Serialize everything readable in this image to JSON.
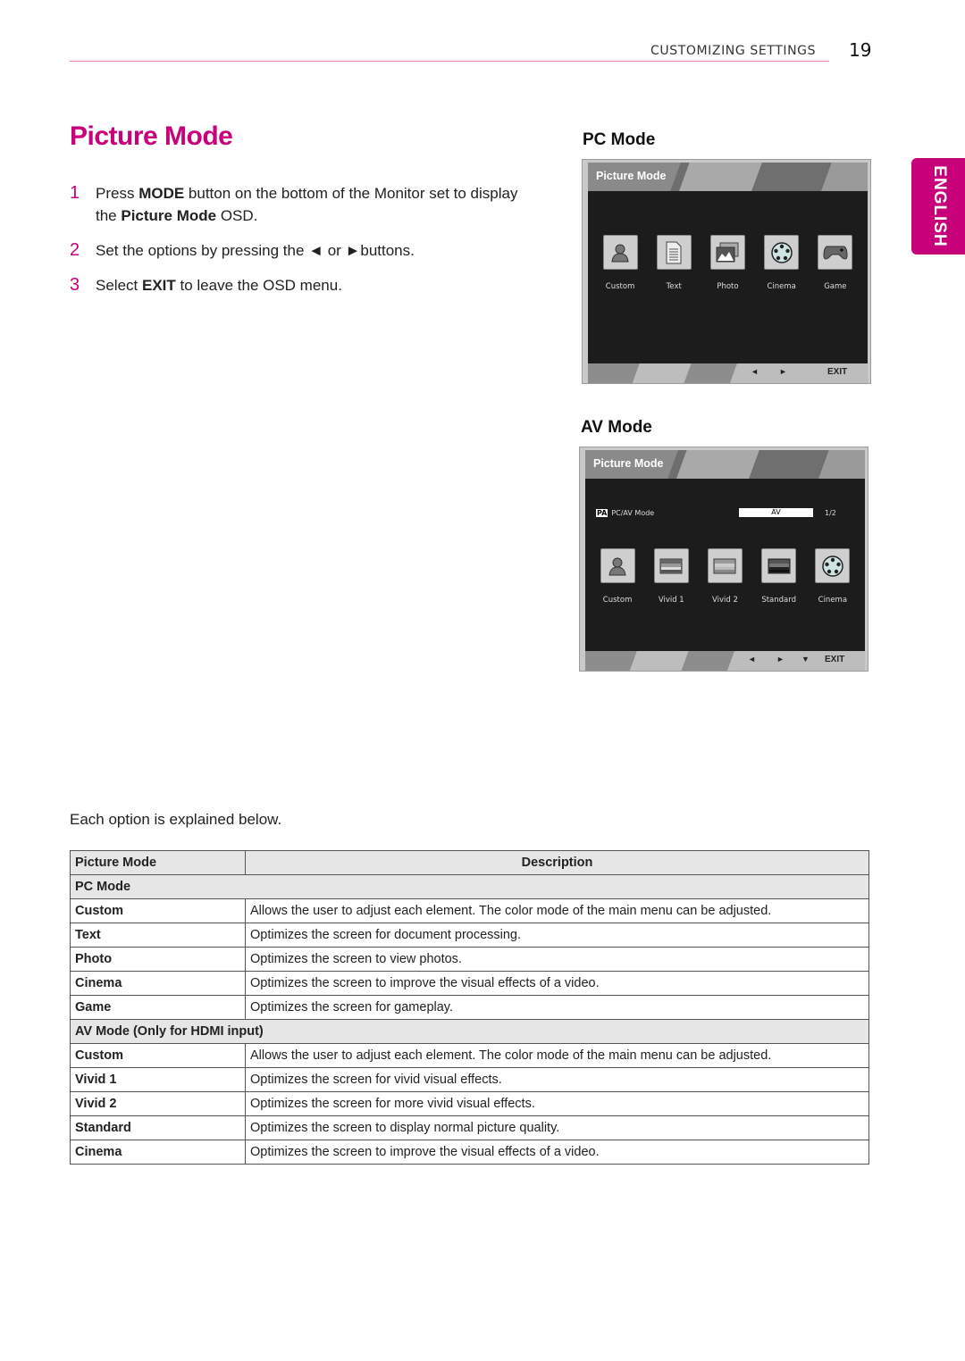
{
  "header": {
    "section": "CUSTOMIZING SETTINGS",
    "page_number": "19"
  },
  "language_tab": "ENGLISH",
  "title": "Picture Mode",
  "steps": [
    {
      "num": "1",
      "parts": [
        [
          "Press ",
          false
        ],
        [
          "MODE",
          true
        ],
        [
          " button on the bottom of the Monitor set to display the ",
          false
        ],
        [
          "Picture Mode",
          true
        ],
        [
          " OSD.",
          false
        ]
      ]
    },
    {
      "num": "2",
      "parts": [
        [
          "Set the options by pressing the ◄ or ►buttons.",
          false
        ]
      ]
    },
    {
      "num": "3",
      "parts": [
        [
          "Select ",
          false
        ],
        [
          "EXIT",
          true
        ],
        [
          " to leave the OSD menu.",
          false
        ]
      ]
    }
  ],
  "pc_osd": {
    "heading": "PC Mode",
    "title": "Picture Mode",
    "items": [
      {
        "label": "Custom",
        "icon": "person-icon"
      },
      {
        "label": "Text",
        "icon": "document-icon"
      },
      {
        "label": "Photo",
        "icon": "photo-icon"
      },
      {
        "label": "Cinema",
        "icon": "film-reel-icon"
      },
      {
        "label": "Game",
        "icon": "gamepad-icon"
      }
    ],
    "nav": {
      "left": "◄",
      "right": "►",
      "exit": "EXIT"
    }
  },
  "av_osd": {
    "heading": "AV Mode",
    "title": "Picture Mode",
    "pcav": {
      "badge": "PA",
      "label": "PC/AV Mode",
      "value": "AV",
      "page": "1/2"
    },
    "items": [
      {
        "label": "Custom",
        "icon": "person-icon"
      },
      {
        "label": "Vivid 1",
        "icon": "vivid1-icon"
      },
      {
        "label": "Vivid 2",
        "icon": "vivid2-icon"
      },
      {
        "label": "Standard",
        "icon": "standard-icon"
      },
      {
        "label": "Cinema",
        "icon": "film-reel-icon"
      }
    ],
    "nav": {
      "left": "◄",
      "right": "►",
      "down": "▼",
      "exit": "EXIT"
    }
  },
  "explain_text": "Each option is explained below.",
  "table": {
    "headers": [
      "Picture Mode",
      "Description"
    ],
    "groups": [
      {
        "name": "PC Mode",
        "rows": [
          [
            "Custom",
            "Allows the user to adjust each element. The color mode of the main menu can be adjusted."
          ],
          [
            "Text",
            "Optimizes the screen for document processing."
          ],
          [
            "Photo",
            "Optimizes the screen to view photos."
          ],
          [
            "Cinema",
            "Optimizes the screen to improve the visual effects of a video."
          ],
          [
            "Game",
            "Optimizes the screen for gameplay."
          ]
        ]
      },
      {
        "name": "AV Mode (Only for HDMI input)",
        "rows": [
          [
            "Custom",
            "Allows the user to adjust each element. The color mode of the main menu can be adjusted."
          ],
          [
            "Vivid 1",
            "Optimizes the screen for vivid visual effects."
          ],
          [
            "Vivid 2",
            "Optimizes the screen for more vivid visual effects."
          ],
          [
            "Standard",
            "Optimizes the screen to display normal picture quality."
          ],
          [
            "Cinema",
            "Optimizes the screen to improve the visual effects of a video."
          ]
        ]
      }
    ]
  }
}
